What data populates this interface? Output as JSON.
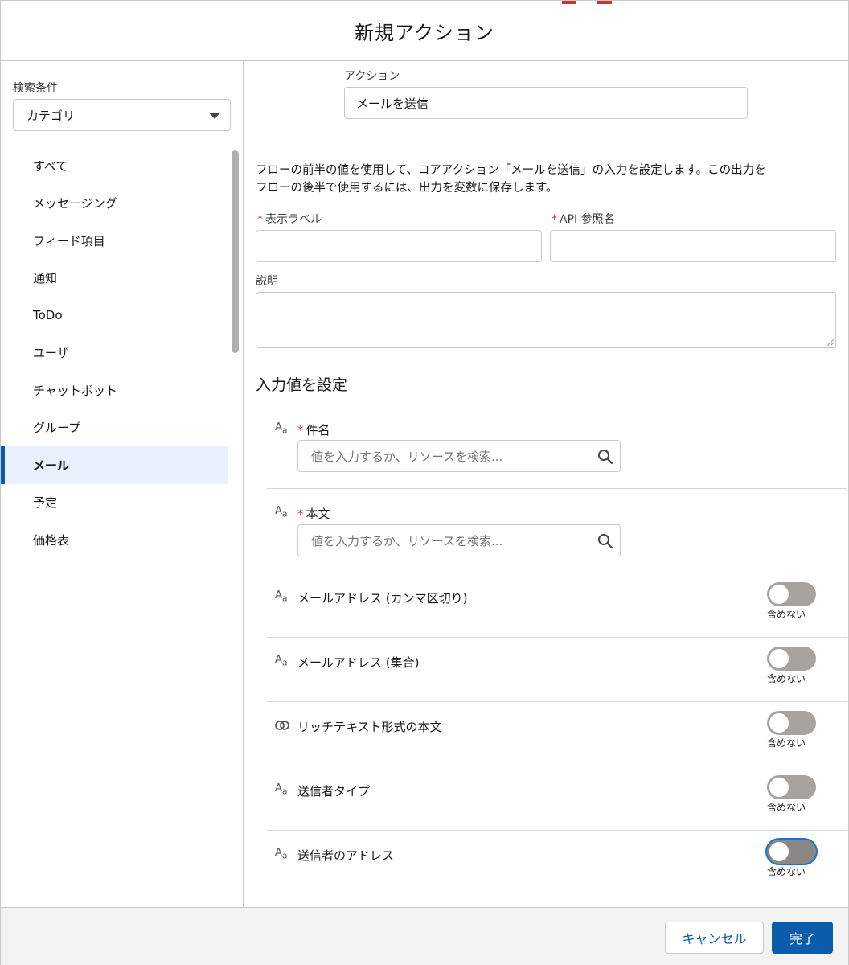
{
  "header": {
    "title": "新規アクション"
  },
  "sidebar": {
    "filter_label": "検索条件",
    "filter_value": "カテゴリ",
    "items": [
      {
        "label": "すべて",
        "active": false
      },
      {
        "label": "メッセージング",
        "active": false
      },
      {
        "label": "フィード項目",
        "active": false
      },
      {
        "label": "通知",
        "active": false
      },
      {
        "label": "ToDo",
        "active": false
      },
      {
        "label": "ユーザ",
        "active": false
      },
      {
        "label": "チャットボット",
        "active": false
      },
      {
        "label": "グループ",
        "active": false
      },
      {
        "label": "メール",
        "active": true
      },
      {
        "label": "予定",
        "active": false
      },
      {
        "label": "価格表",
        "active": false
      }
    ]
  },
  "main": {
    "action_label": "アクション",
    "action_value": "メールを送信",
    "description_line1": "フローの前半の値を使用して、コアアクション「メールを送信」の入力を設定します。この出力を",
    "description_line2": "フローの後半で使用するには、出力を変数に保存します。",
    "required_mark": "*",
    "display_label": "表示ラベル",
    "api_name_label": "API 参照名",
    "explanation_label": "説明",
    "section_title": "入力値を設定"
  },
  "params": {
    "subject": {
      "label": "件名",
      "placeholder": "値を入力するか、リソースを検索..."
    },
    "body": {
      "label": "本文",
      "placeholder": "値を入力するか、リソースを検索..."
    },
    "email_addresses_csv": {
      "label": "メールアドレス (カンマ区切り)",
      "toggle_caption": "含めない"
    },
    "email_addresses_collection": {
      "label": "メールアドレス (集合)",
      "toggle_caption": "含めない"
    },
    "rich_text_body": {
      "label": "リッチテキスト形式の本文",
      "toggle_caption": "含めない"
    },
    "sender_type": {
      "label": "送信者タイプ",
      "toggle_caption": "含めない"
    },
    "sender_address": {
      "label": "送信者のアドレス",
      "toggle_caption": "含めない"
    },
    "text_icon": "A",
    "text_icon_sub": "a"
  },
  "footer": {
    "cancel_label": "キャンセル",
    "done_label": "完了"
  },
  "colors": {
    "brand": "#0b5cab",
    "required": "#c23934",
    "active_bg": "#e8f1fc",
    "toggle_off": "#a7a49f"
  }
}
